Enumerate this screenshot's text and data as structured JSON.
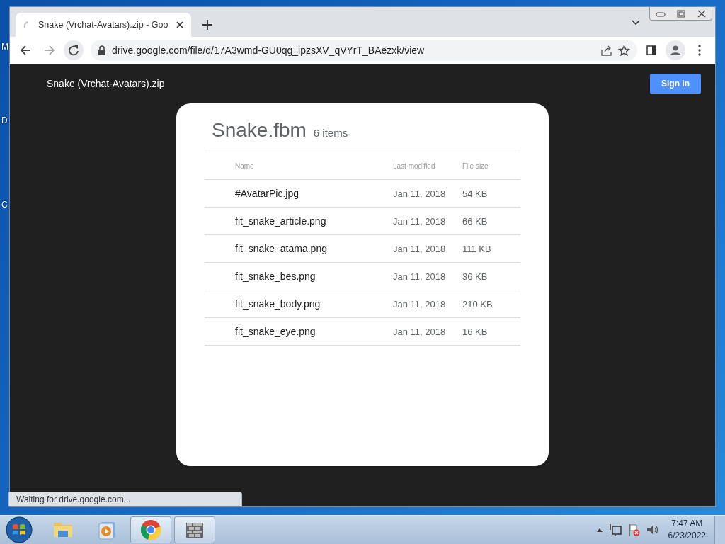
{
  "desktop_labels": [
    "M",
    "D",
    "C"
  ],
  "browser": {
    "tab": {
      "title": "Snake (Vrchat-Avatars).zip - Goo",
      "loading": true
    },
    "address": "drive.google.com/file/d/17A3wmd-GU0qg_ipzsXV_qVYrT_BAezxk/view",
    "status_text": "Waiting for drive.google.com..."
  },
  "page": {
    "file_title": "Snake (Vrchat-Avatars).zip",
    "sign_in": "Sign In",
    "folder": {
      "name": "Snake.fbm",
      "count": "6 items",
      "columns": [
        "Name",
        "Last modified",
        "File size"
      ],
      "rows": [
        {
          "name": "#AvatarPic.jpg",
          "modified": "Jan 11, 2018",
          "size": "54 KB"
        },
        {
          "name": "fit_snake_article.png",
          "modified": "Jan 11, 2018",
          "size": "66 KB"
        },
        {
          "name": "fit_snake_atama.png",
          "modified": "Jan 11, 2018",
          "size": "111 KB"
        },
        {
          "name": "fit_snake_bes.png",
          "modified": "Jan 11, 2018",
          "size": "36 KB"
        },
        {
          "name": "fit_snake_body.png",
          "modified": "Jan 11, 2018",
          "size": "210 KB"
        },
        {
          "name": "fit_snake_eye.png",
          "modified": "Jan 11, 2018",
          "size": "16 KB"
        }
      ]
    }
  },
  "taskbar": {
    "apps": [
      {
        "kind": "folder",
        "running": false
      },
      {
        "kind": "media",
        "running": false
      },
      {
        "kind": "chrome",
        "running": true
      },
      {
        "kind": "wall",
        "running": true
      }
    ],
    "clock": {
      "time": "7:47 AM",
      "date": "6/23/2022"
    }
  }
}
